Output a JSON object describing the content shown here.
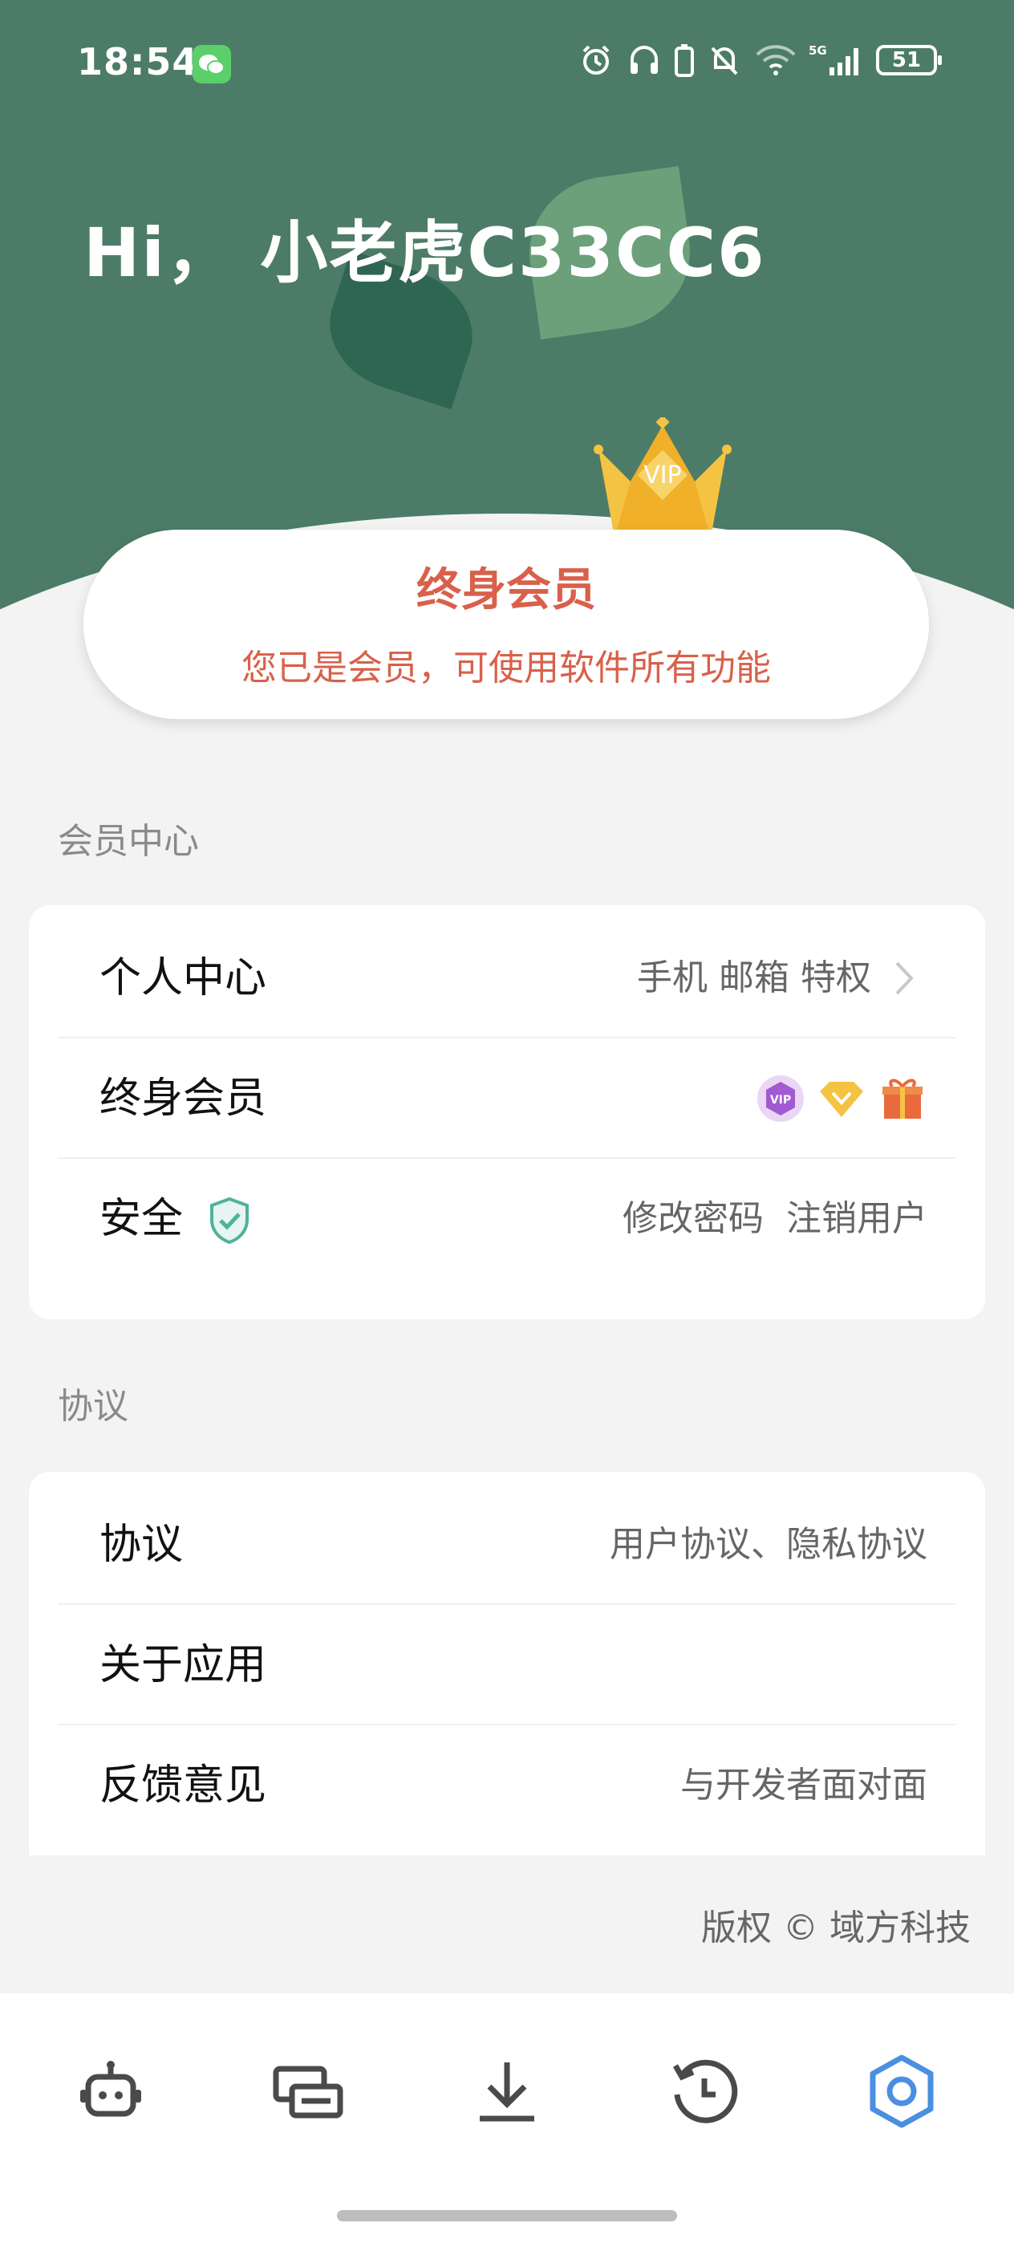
{
  "status_bar": {
    "time": "18:54",
    "battery": "51",
    "network": "5G"
  },
  "header": {
    "greeting": "Hi， 小老虎C33CC6",
    "crown_text": "VIP"
  },
  "member_card": {
    "title": "终身会员",
    "subtitle": "您已是会员，可使用软件所有功能"
  },
  "sections": {
    "member_center": {
      "label": "会员中心",
      "rows": {
        "personal": {
          "label": "个人中心",
          "value": "手机 邮箱 特权"
        },
        "lifetime": {
          "label": "终身会员",
          "badge_text": "VIP"
        },
        "security": {
          "label": "安全",
          "value": "修改密码  注销用户"
        }
      }
    },
    "agreement": {
      "label": "协议",
      "rows": {
        "agreement": {
          "label": "协议",
          "value": "用户协议、隐私协议"
        },
        "about": {
          "label": "关于应用"
        },
        "feedback": {
          "label": "反馈意见",
          "value": "与开发者面对面"
        }
      }
    }
  },
  "copyright": "版权 © 域方科技",
  "bottom_nav": {
    "items": [
      "robot-icon",
      "cards-icon",
      "download-icon",
      "history-icon",
      "settings-icon"
    ],
    "active": "settings-icon",
    "active_color": "#4a8fe0",
    "inactive_color": "#4a4a4a"
  },
  "colors": {
    "header": "#4c7c67",
    "accent_red": "#d9604a",
    "shield": "#4fb29a"
  }
}
